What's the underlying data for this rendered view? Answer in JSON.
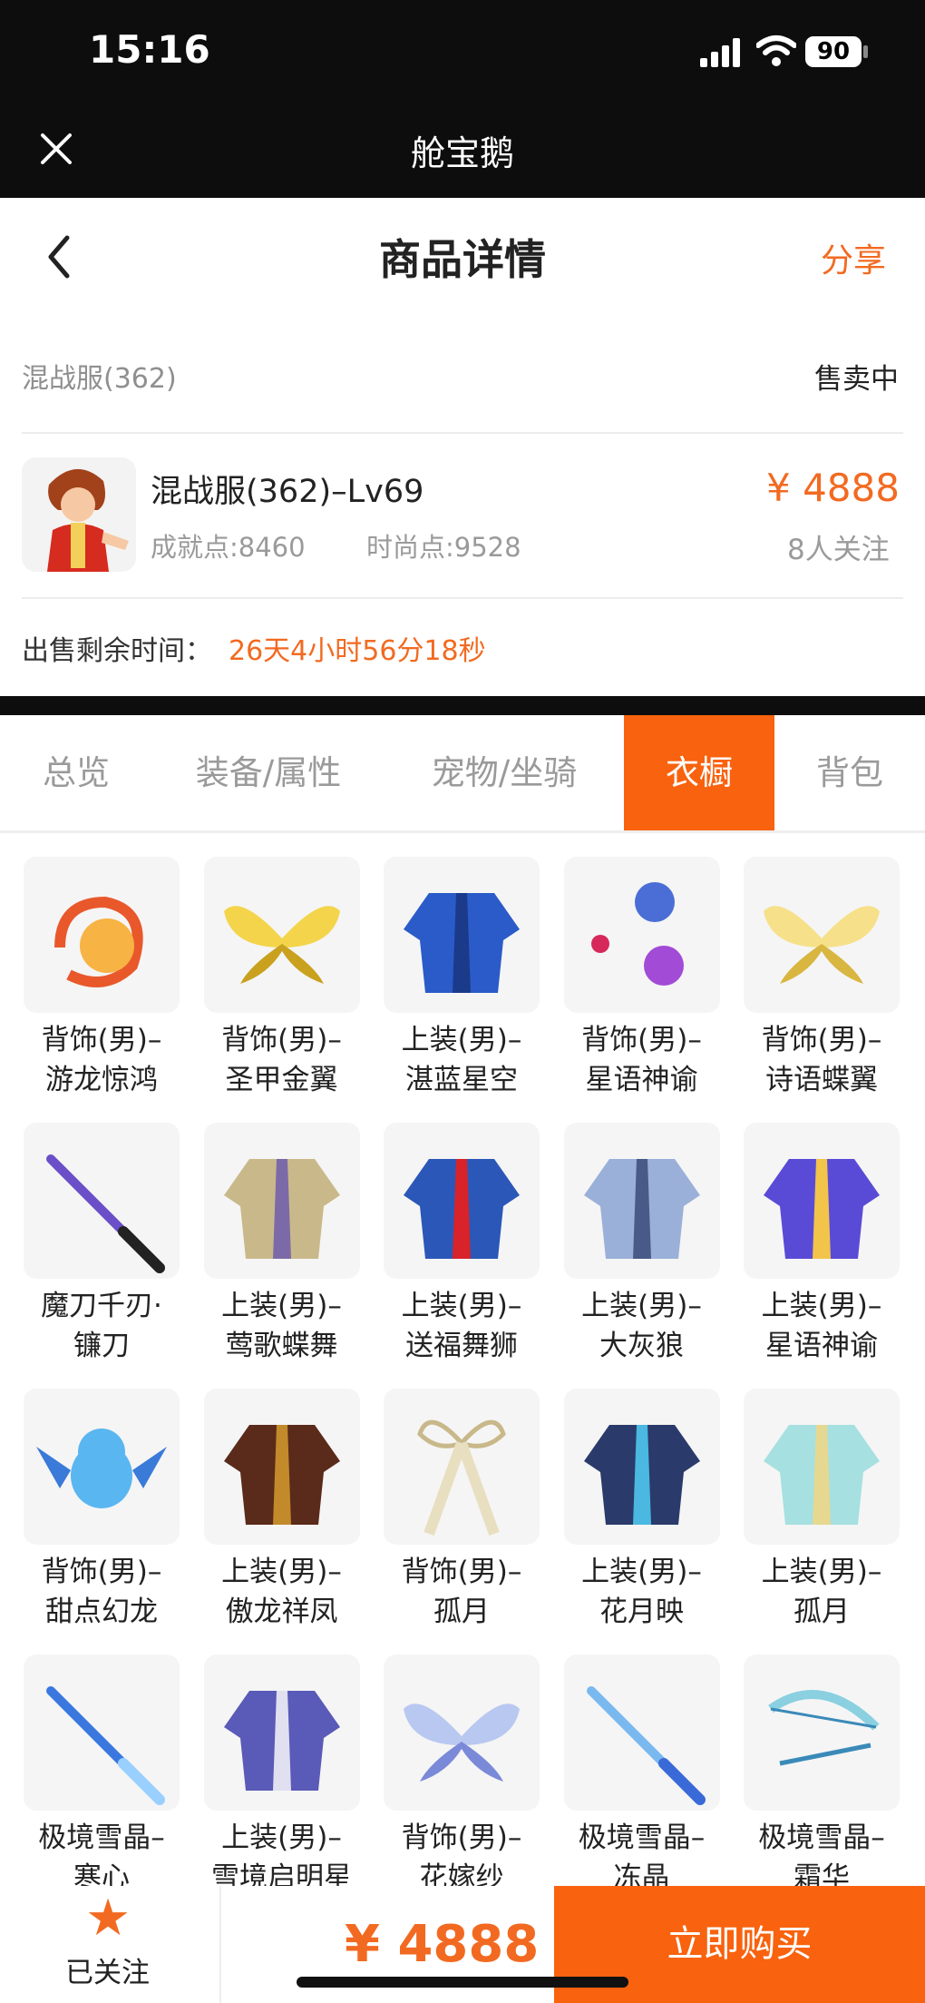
{
  "status_bar": {
    "time": "15:16",
    "battery": "90"
  },
  "app_bar": {
    "title": "舱宝鹅"
  },
  "header": {
    "title": "商品详情",
    "share_label": "分享"
  },
  "listing": {
    "server": "混战服(362)",
    "status": "售卖中",
    "name": "混战服(362)–Lv69",
    "price": "¥ 4888",
    "achievement": "成就点:8460",
    "fashion": "时尚点:9528",
    "watchers": "8人关注",
    "remaining_label": "出售剩余时间：",
    "remaining_value": "26天4小时56分18秒"
  },
  "tabs": [
    "总览",
    "装备/属性",
    "宠物/坐骑",
    "衣橱",
    "背包"
  ],
  "active_tab": "衣橱",
  "wardrobe": [
    {
      "line1": "背饰(男)–",
      "line2": "游龙惊鸿",
      "icon": "dragon-back-ornament-icon"
    },
    {
      "line1": "背饰(男)–",
      "line2": "圣甲金翼",
      "icon": "gold-wings-icon"
    },
    {
      "line1": "上装(男)–",
      "line2": "湛蓝星空",
      "icon": "blue-coat-icon"
    },
    {
      "line1": "背饰(男)–",
      "line2": "星语神谕",
      "icon": "orbs-back-ornament-icon"
    },
    {
      "line1": "背饰(男)–",
      "line2": "诗语蝶翼",
      "icon": "butterfly-wings-icon"
    },
    {
      "line1": "魔刀千刃·",
      "line2": "镰刀",
      "icon": "katana-icon"
    },
    {
      "line1": "上装(男)–",
      "line2": "莺歌蝶舞",
      "icon": "feather-armor-icon"
    },
    {
      "line1": "上装(男)–",
      "line2": "送福舞狮",
      "icon": "lion-dance-outfit-icon"
    },
    {
      "line1": "上装(男)–",
      "line2": "大灰狼",
      "icon": "apron-outfit-icon"
    },
    {
      "line1": "上装(男)–",
      "line2": "星语神谕",
      "icon": "oracle-armor-icon"
    },
    {
      "line1": "背饰(男)–",
      "line2": "甜点幻龙",
      "icon": "baby-dragon-icon"
    },
    {
      "line1": "上装(男)–",
      "line2": "傲龙祥凤",
      "icon": "dragon-robe-icon"
    },
    {
      "line1": "背饰(男)–",
      "line2": "孤月",
      "icon": "ribbon-back-ornament-icon"
    },
    {
      "line1": "上装(男)–",
      "line2": "花月映",
      "icon": "navy-coat-icon"
    },
    {
      "line1": "上装(男)–",
      "line2": "孤月",
      "icon": "mint-robe-icon"
    },
    {
      "line1": "极境雪晶–",
      "line2": "寒心",
      "icon": "ice-sword-icon"
    },
    {
      "line1": "上装(男)–",
      "line2": "雪境启明星",
      "icon": "purple-robe-icon"
    },
    {
      "line1": "背饰(男)–",
      "line2": "花嫁纱",
      "icon": "veil-wings-icon"
    },
    {
      "line1": "极境雪晶–",
      "line2": "冻晶",
      "icon": "ice-spear-icon"
    },
    {
      "line1": "极境雪晶–",
      "line2": "霜华",
      "icon": "ice-bow-icon"
    }
  ],
  "bottom_bar": {
    "follow_label": "已关注",
    "price": "¥ 4888",
    "buy_label": "立即购买"
  }
}
